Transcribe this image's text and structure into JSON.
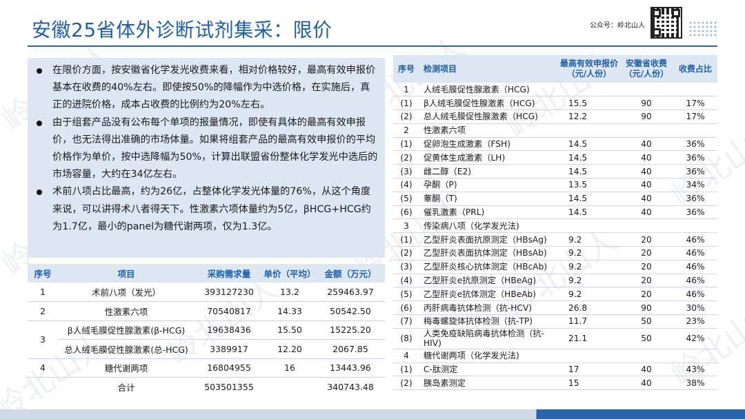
{
  "title": "安徽25省体外诊断试剂集采：限价",
  "official_account": "公众号：岭北山人",
  "watermark_text": "岭北山人",
  "bullets": [
    "在限价方面，按安徽省化学发光收费来看，相对价格较好，最高有效申报价基本在收费的40%左右。即使按50%的降幅作为中选价格，在实施后，真正的进院价格，成本占收费的比例约为20%左右。",
    "由于组套产品没有公布每个单项的报量情况，即使有具体的最高有效申报价，也无法得出准确的市场体量。如果将组套产品的最高有效申报价的平均价格作为单价，按中选降幅为50%，计算出联盟省份整体化学发光中选后的市场容量，大约在34亿左右。",
    "术前八项占比最高，约为26亿，占整体化学发光体量的76%，从这个角度来说，可以讲得术八者得天下。性激素六项体量约为5亿，βHCG+HCG约为1.7亿，最小的panel为糖代谢两项，仅为1.3亿。"
  ],
  "left_table": {
    "headers": [
      "序号",
      "项目",
      "采购需求量",
      "单价（平均）",
      "金额（万元）"
    ],
    "rows": [
      {
        "no": "1",
        "item": "术前八项（发光）",
        "qty": "393127230",
        "price": "13.2",
        "amount": "259463.97"
      },
      {
        "no": "2",
        "item": "性激素六项",
        "qty": "70540817",
        "price": "14.33",
        "amount": "50542.50"
      },
      {
        "no": "3",
        "item": "β人绒毛膜促性腺激素(β-HCG)",
        "qty": "19638436",
        "price": "15.50",
        "amount": "15225.20"
      },
      {
        "no": "",
        "item": "总人绒毛膜促性腺激素(总-HCG)",
        "qty": "3389917",
        "price": "12.20",
        "amount": "2067.85"
      },
      {
        "no": "4",
        "item": "糖代谢两项",
        "qty": "16804955",
        "price": "16",
        "amount": "13443.96"
      },
      {
        "no": "",
        "item": "合计",
        "qty": "503501355",
        "price": "",
        "amount": "340743.48"
      }
    ]
  },
  "right_table": {
    "headers": [
      "序号",
      "检测项目",
      "最高有效申报价（元/人份）",
      "安徽省收费（元/人份）",
      "收费占比"
    ],
    "rows": [
      {
        "no": "1",
        "item": "人绒毛膜促性腺激素（HCG)",
        "max": "",
        "fee": "",
        "ratio": "",
        "section": true
      },
      {
        "no": "(1)",
        "item": "β人绒毛膜促性腺激素（HCG)",
        "max": "15.5",
        "fee": "90",
        "ratio": "17%"
      },
      {
        "no": "(2)",
        "item": "总人绒毛膜促性腺激素（HCG)",
        "max": "12.2",
        "fee": "90",
        "ratio": "17%"
      },
      {
        "no": "2",
        "item": "性激素六项",
        "max": "",
        "fee": "",
        "ratio": "",
        "section": true
      },
      {
        "no": "(1)",
        "item": "促卵泡生成激素（FSH)",
        "max": "14.5",
        "fee": "40",
        "ratio": "36%"
      },
      {
        "no": "(2)",
        "item": "促黄体生成激素（LH)",
        "max": "14.5",
        "fee": "40",
        "ratio": "36%"
      },
      {
        "no": "(3)",
        "item": "雌二醇（E2)",
        "max": "14.5",
        "fee": "40",
        "ratio": "36%"
      },
      {
        "no": "(4)",
        "item": "孕酮（P)",
        "max": "13.5",
        "fee": "40",
        "ratio": "34%"
      },
      {
        "no": "(5)",
        "item": "睾酮（T)",
        "max": "14.5",
        "fee": "40",
        "ratio": "36%"
      },
      {
        "no": "(6)",
        "item": "催乳激素（PRL)",
        "max": "14.5",
        "fee": "40",
        "ratio": "36%"
      },
      {
        "no": "3",
        "item": "传染病八项（化学发光法)",
        "max": "",
        "fee": "",
        "ratio": "",
        "section": true
      },
      {
        "no": "(1)",
        "item": "乙型肝炎表面抗原测定（HBsAg)",
        "max": "9.2",
        "fee": "20",
        "ratio": "46%"
      },
      {
        "no": "(2)",
        "item": "乙型肝炎表面抗体测定（HBsAb)",
        "max": "9.2",
        "fee": "20",
        "ratio": "46%"
      },
      {
        "no": "(3)",
        "item": "乙型肝炎核心抗体测定（HBcAb)",
        "max": "9.2",
        "fee": "20",
        "ratio": "46%"
      },
      {
        "no": "(4)",
        "item": "乙型肝炎e抗原测定（HBeAg)",
        "max": "9.2",
        "fee": "20",
        "ratio": "46%"
      },
      {
        "no": "(5)",
        "item": "乙型肝炎e抗体测定（HBeAb)",
        "max": "9.2",
        "fee": "20",
        "ratio": "46%"
      },
      {
        "no": "(6)",
        "item": "丙肝病毒抗体检测（抗-HCV)",
        "max": "26.8",
        "fee": "90",
        "ratio": "30%"
      },
      {
        "no": "(7)",
        "item": "梅毒螺旋体抗体检测（抗-TP)",
        "max": "11.7",
        "fee": "50",
        "ratio": "23%"
      },
      {
        "no": "(8)",
        "item": "人类免疫缺陷病毒抗体检测（抗-HIV)",
        "max": "21.1",
        "fee": "50",
        "ratio": "42%",
        "tall": true
      },
      {
        "no": "4",
        "item": "糖代谢两项（化学发光法)",
        "max": "",
        "fee": "",
        "ratio": "",
        "section": true
      },
      {
        "no": "(1)",
        "item": "C-肽测定",
        "max": "17",
        "fee": "40",
        "ratio": "43%"
      },
      {
        "no": "(2)",
        "item": "胰岛素测定",
        "max": "15",
        "fee": "40",
        "ratio": "38%"
      }
    ]
  },
  "colors": {
    "accent": "#1f5fa8",
    "panel": "#dde6f3",
    "rule": "#2a62ac"
  }
}
